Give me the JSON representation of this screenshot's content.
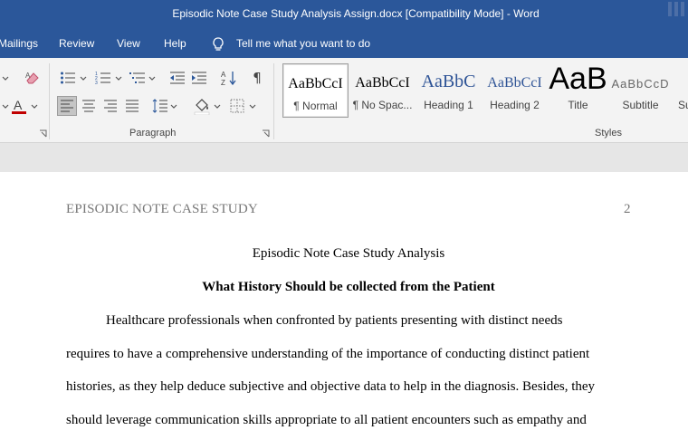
{
  "window": {
    "title": "Episodic Note Case Study Analysis Assign.docx [Compatibility Mode]  -  Word"
  },
  "tabs": [
    {
      "label": "Mailings"
    },
    {
      "label": "Review"
    },
    {
      "label": "View"
    },
    {
      "label": "Help"
    }
  ],
  "tell_me": {
    "label": "Tell me what you want to do"
  },
  "ribbon": {
    "paragraph_group": {
      "label": "Paragraph"
    },
    "styles_group": {
      "label": "Styles"
    },
    "styles": [
      {
        "sample": "AaBbCcI",
        "name": "¶ Normal",
        "selected": true
      },
      {
        "sample": "AaBbCcI",
        "name": "¶ No Spac..."
      },
      {
        "sample": "AaBbC",
        "name": "Heading 1"
      },
      {
        "sample": "AaBbCcI",
        "name": "Heading 2"
      },
      {
        "sample": "AaB",
        "name": "Title"
      },
      {
        "sample": "AaBbCcD",
        "name": "Subtitle"
      },
      {
        "sample": "",
        "name": "Su"
      }
    ],
    "colors": {
      "font_color": "#c00000",
      "highlight": "#ffff00",
      "heading": "#2f5496"
    }
  },
  "document": {
    "running_head": "EPISODIC NOTE CASE STUDY",
    "page_number": "2",
    "title": "Episodic Note Case Study Analysis",
    "heading": "What History Should be collected from the Patient",
    "lines": [
      "Healthcare professionals when confronted by patients presenting with distinct needs",
      "requires to have a comprehensive understanding of the importance of conducting distinct patient",
      "histories, as they help deduce subjective and objective data to help in the diagnosis. Besides, they",
      "should leverage communication skills appropriate to all patient encounters such as empathy and"
    ]
  }
}
